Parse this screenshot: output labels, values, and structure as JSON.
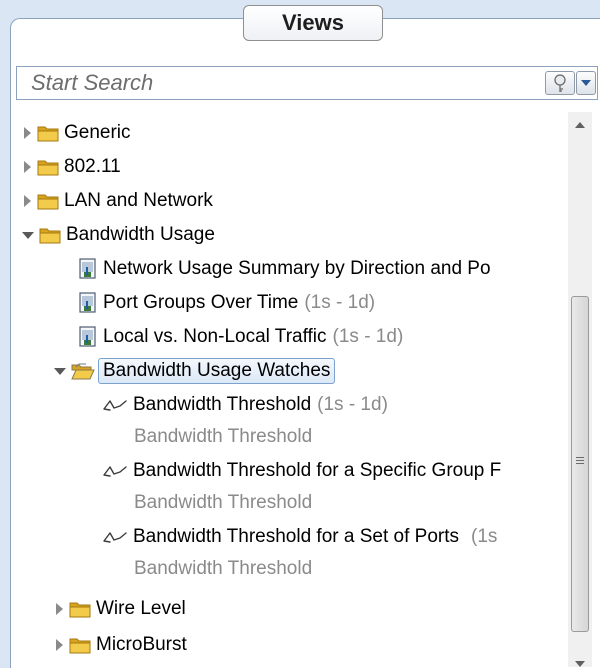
{
  "panel": {
    "tab_label": "Views"
  },
  "search": {
    "placeholder": "Start Search"
  },
  "tree": {
    "generic": "Generic",
    "n80211": "802.11",
    "lan": "LAN and Network",
    "bandwidth_usage": "Bandwidth Usage",
    "view1": "Network Usage Summary by Direction and Po",
    "view2": "Port Groups Over Time",
    "view2_range": "(1s - 1d)",
    "view3": "Local vs. Non-Local Traffic",
    "view3_range": "(1s - 1d)",
    "watches": "Bandwidth Usage Watches",
    "watch1": "Bandwidth Threshold",
    "watch1_range": "(1s - 1d)",
    "watch1_sub": "Bandwidth Threshold",
    "watch2": "Bandwidth Threshold for a Specific Group F",
    "watch2_sub": "Bandwidth Threshold",
    "watch3": "Bandwidth Threshold for a Set of Ports",
    "watch3_range": "(1s",
    "watch3_sub": "Bandwidth Threshold",
    "wire_level": "Wire Level",
    "microburst": "MicroBurst"
  },
  "colors": {
    "folder": "#e8b931",
    "selection": "#dbe8f7",
    "dim_text": "#8a8a8a"
  },
  "icons": {
    "folder": "folder-icon",
    "open_folder": "open-folder-icon",
    "report": "report-icon",
    "watch": "watch-icon",
    "search_button": "key-icon"
  }
}
